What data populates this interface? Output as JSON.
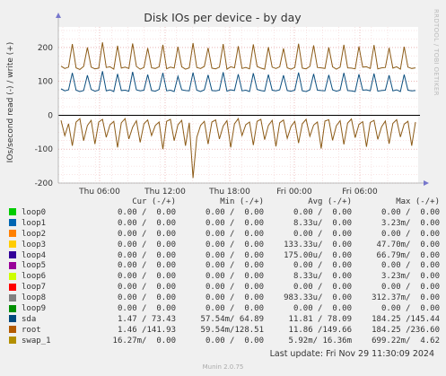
{
  "chart_data": {
    "type": "line",
    "title": "Disk IOs per device - by day",
    "ylabel": "IOs/second read (-) / write (+)",
    "ylim": [
      -200,
      250
    ],
    "yticks": [
      -200,
      -100,
      0,
      100,
      200
    ],
    "xticks": [
      "Thu 06:00",
      "Thu 12:00",
      "Thu 18:00",
      "Fri 00:00",
      "Fri 06:00"
    ],
    "series": [
      {
        "name": "sda",
        "color": "#0d4f7f",
        "write_values": [
          78,
          72,
          75,
          125,
          74,
          70,
          73,
          118,
          76,
          71,
          74,
          130,
          72,
          75,
          70,
          122,
          73,
          74,
          71,
          128,
          75,
          72,
          74,
          120,
          73,
          71,
          76,
          125,
          72,
          74,
          70,
          115,
          75,
          73,
          72,
          126,
          74,
          70,
          75,
          119,
          73,
          72,
          74,
          127,
          71,
          75,
          73,
          121,
          72,
          74,
          70,
          124,
          76,
          73,
          71,
          120,
          74,
          72,
          75,
          118,
          73,
          71,
          74,
          126,
          72,
          70,
          75,
          122,
          74,
          73,
          72,
          119,
          75,
          71,
          74,
          125,
          73,
          72,
          70,
          121,
          74,
          75,
          72,
          123,
          71,
          73,
          74,
          118,
          72,
          75,
          70,
          120,
          74,
          72,
          73
        ],
        "read_values": []
      },
      {
        "name": "root",
        "color": "#8c5b17",
        "write_values": [
          145,
          138,
          142,
          210,
          140,
          135,
          144,
          200,
          142,
          137,
          139,
          215,
          141,
          143,
          136,
          205,
          139,
          142,
          138,
          212,
          144,
          136,
          141,
          198,
          140,
          138,
          143,
          208,
          137,
          142,
          139,
          202,
          143,
          136,
          140,
          213,
          141,
          138,
          144,
          199,
          139,
          137,
          142,
          210,
          136,
          143,
          140,
          204,
          138,
          141,
          137,
          209,
          144,
          139,
          136,
          201,
          142,
          138,
          143,
          197,
          140,
          136,
          141,
          211,
          139,
          137,
          144,
          206,
          141,
          140,
          138,
          200,
          143,
          136,
          142,
          208,
          140,
          139,
          137,
          203,
          142,
          143,
          138,
          207,
          137,
          140,
          141,
          199,
          139,
          143,
          136,
          202,
          142,
          138,
          140
        ],
        "read_values": [
          -15,
          -60,
          -25,
          -90,
          -20,
          -10,
          -75,
          -30,
          -15,
          -85,
          -20,
          -12,
          -65,
          -28,
          -18,
          -95,
          -22,
          -10,
          -70,
          -35,
          -16,
          -80,
          -25,
          -14,
          -60,
          -30,
          -20,
          -100,
          -18,
          -12,
          -75,
          -28,
          -15,
          -90,
          -22,
          -185,
          -65,
          -30,
          -18,
          -85,
          -20,
          -14,
          -70,
          -32,
          -16,
          -95,
          -25,
          -10,
          -60,
          -28,
          -20,
          -88,
          -18,
          -12,
          -72,
          -30,
          -15,
          -92,
          -22,
          -14,
          -68,
          -33,
          -18,
          -82,
          -25,
          -12,
          -62,
          -29,
          -20,
          -98,
          -17,
          -13,
          -74,
          -31,
          -16,
          -86,
          -23,
          -11,
          -66,
          -27,
          -19,
          -93,
          -21,
          -15,
          -71,
          -34,
          -17,
          -84,
          -24,
          -13,
          -64,
          -26,
          -18,
          -90,
          -20
        ]
      }
    ],
    "legend_headers": [
      "Cur (-/+)",
      "Min (-/+)",
      "Avg (-/+)",
      "Max (-/+)"
    ],
    "legend": [
      {
        "name": "loop0",
        "color": "#00cc00",
        "cur": "0.00 /  0.00",
        "min": "0.00 /  0.00",
        "avg": "0.00 /  0.00",
        "max": "0.00 /  0.00"
      },
      {
        "name": "loop1",
        "color": "#0066b3",
        "cur": "0.00 /  0.00",
        "min": "0.00 /  0.00",
        "avg": "8.33u/  0.00",
        "max": "3.23m/  0.00"
      },
      {
        "name": "loop2",
        "color": "#ff8000",
        "cur": "0.00 /  0.00",
        "min": "0.00 /  0.00",
        "avg": "0.00 /  0.00",
        "max": "0.00 /  0.00"
      },
      {
        "name": "loop3",
        "color": "#ffcc00",
        "cur": "0.00 /  0.00",
        "min": "0.00 /  0.00",
        "avg": "133.33u/  0.00",
        "max": "47.70m/  0.00"
      },
      {
        "name": "loop4",
        "color": "#330099",
        "cur": "0.00 /  0.00",
        "min": "0.00 /  0.00",
        "avg": "175.00u/  0.00",
        "max": "66.79m/  0.00"
      },
      {
        "name": "loop5",
        "color": "#990099",
        "cur": "0.00 /  0.00",
        "min": "0.00 /  0.00",
        "avg": "0.00 /  0.00",
        "max": "0.00 /  0.00"
      },
      {
        "name": "loop6",
        "color": "#ccff00",
        "cur": "0.00 /  0.00",
        "min": "0.00 /  0.00",
        "avg": "8.33u/  0.00",
        "max": "3.23m/  0.00"
      },
      {
        "name": "loop7",
        "color": "#ff0000",
        "cur": "0.00 /  0.00",
        "min": "0.00 /  0.00",
        "avg": "0.00 /  0.00",
        "max": "0.00 /  0.00"
      },
      {
        "name": "loop8",
        "color": "#808080",
        "cur": "0.00 /  0.00",
        "min": "0.00 /  0.00",
        "avg": "983.33u/  0.00",
        "max": "312.37m/  0.00"
      },
      {
        "name": "loop9",
        "color": "#008f00",
        "cur": "0.00 /  0.00",
        "min": "0.00 /  0.00",
        "avg": "0.00 /  0.00",
        "max": "0.00 /  0.00"
      },
      {
        "name": "sda",
        "color": "#00487d",
        "cur": "1.47 / 73.43",
        "min": "57.54m/ 64.89",
        "avg": "11.81 / 78.09",
        "max": "184.25 /145.44"
      },
      {
        "name": "root",
        "color": "#b35a00",
        "cur": "1.46 /141.93",
        "min": "59.54m/128.51",
        "avg": "11.86 /149.66",
        "max": "184.25 /236.60"
      },
      {
        "name": "swap_1",
        "color": "#b38f00",
        "cur": "16.27m/  0.00",
        "min": "0.00 /  0.00",
        "avg": "5.92m/ 16.36m",
        "max": "699.22m/  4.62"
      }
    ]
  },
  "footer": {
    "last_update": "Last update: Fri Nov 29 11:30:09 2024",
    "munin_version": "Munin 2.0.75"
  },
  "side_label": "RRDTOOL / TOBI OETIKER"
}
